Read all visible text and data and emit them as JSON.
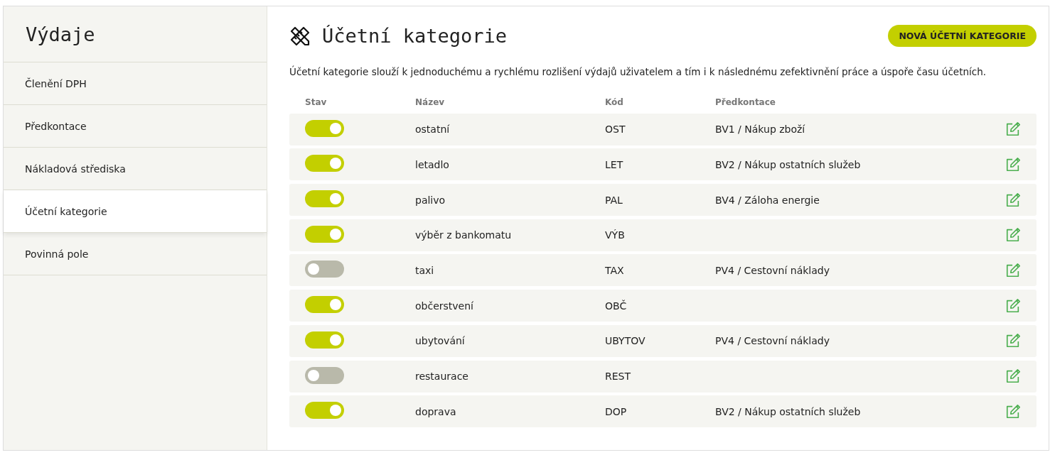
{
  "sidebar": {
    "title": "Výdaje",
    "items": [
      {
        "label": "Členění DPH",
        "selected": false
      },
      {
        "label": "Předkontace",
        "selected": false
      },
      {
        "label": "Nákladová střediska",
        "selected": false
      },
      {
        "label": "Účetní kategorie",
        "selected": true
      },
      {
        "label": "Povinná pole",
        "selected": false
      }
    ]
  },
  "main": {
    "title": "Účetní kategorie",
    "new_button": "NOVÁ ÚČETNÍ KATEGORIE",
    "description": "Účetní kategorie slouží k jednoduchému a rychlému rozlišení výdajů uživatelem a tím i k následnému zefektivnění práce a úspoře času účetních.",
    "table": {
      "columns": [
        "Stav",
        "Název",
        "Kód",
        "Předkontace"
      ],
      "rows": [
        {
          "on": true,
          "name": "ostatní",
          "code": "OST",
          "posting": "BV1 / Nákup zboží"
        },
        {
          "on": true,
          "name": "letadlo",
          "code": "LET",
          "posting": "BV2 / Nákup ostatních služeb"
        },
        {
          "on": true,
          "name": "palivo",
          "code": "PAL",
          "posting": "BV4 / Záloha energie"
        },
        {
          "on": true,
          "name": "výběr z bankomatu",
          "code": "VÝB"
        },
        {
          "on": false,
          "name": "taxi",
          "code": "TAX",
          "posting": "PV4 / Cestovní náklady"
        },
        {
          "on": true,
          "name": "občerstvení",
          "code": "OBČ"
        },
        {
          "on": true,
          "name": "ubytování",
          "code": "UBYTOV",
          "posting": "PV4 / Cestovní náklady"
        },
        {
          "on": false,
          "name": "restaurace",
          "code": "REST"
        },
        {
          "on": true,
          "name": "doprava",
          "code": "DOP",
          "posting": "BV2 / Nákup ostatních služeb"
        }
      ]
    }
  }
}
